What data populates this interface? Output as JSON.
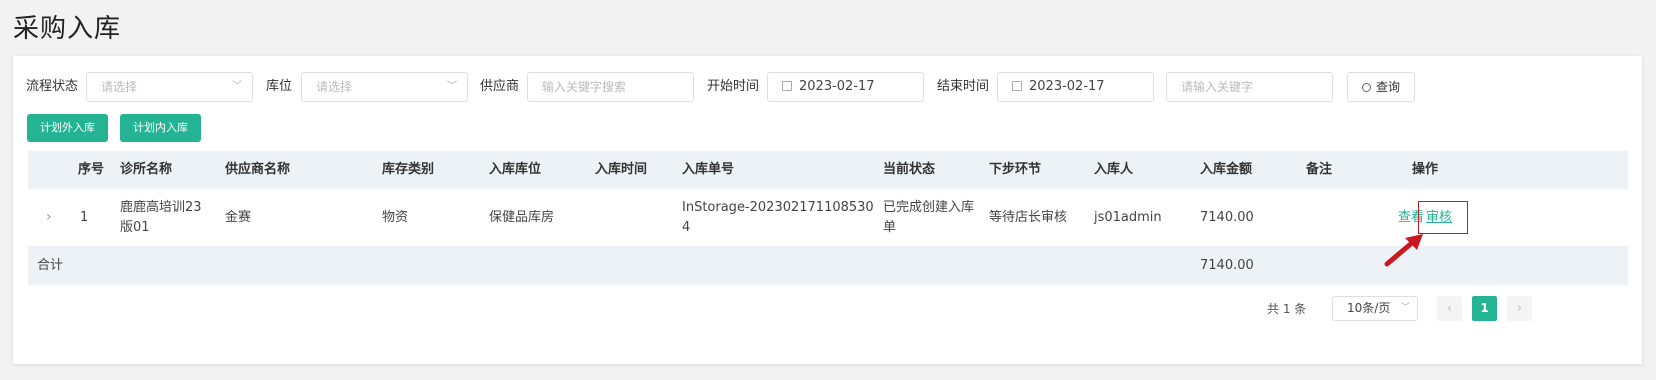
{
  "page": {
    "title": "采购入库"
  },
  "filters": {
    "status": {
      "label": "流程状态",
      "placeholder": "请选择"
    },
    "location": {
      "label": "库位",
      "placeholder": "请选择"
    },
    "supplier": {
      "label": "供应商",
      "placeholder": "输入关键字搜索"
    },
    "start": {
      "label": "开始时间",
      "value": "2023-02-17"
    },
    "end": {
      "label": "结束时间",
      "value": "2023-02-17"
    },
    "keyword": {
      "placeholder": "请输入关键字"
    },
    "query_label": "查询"
  },
  "actions": {
    "unplanned": "计划外入库",
    "planned": "计划内入库"
  },
  "table": {
    "headers": [
      "序号",
      "诊所名称",
      "供应商名称",
      "库存类别",
      "入库库位",
      "入库时间",
      "入库单号",
      "当前状态",
      "下步环节",
      "入库人",
      "入库金额",
      "备注",
      "操作"
    ],
    "rows": [
      {
        "index": "1",
        "clinic_line1": "鹿鹿高培训23",
        "clinic_line2": "版01",
        "supplier": "金赛",
        "category": "物资",
        "location": "保健品库房",
        "time": "",
        "order_line1": "InStorage-202302171108530",
        "order_line2": "4",
        "status_line1": "已完成创建入库",
        "status_line2": "单",
        "next_step": "等待店长审核",
        "operator": "js01admin",
        "amount": "7140.00",
        "remark": "",
        "op_view": "查看",
        "op_audit": "审核"
      }
    ],
    "summary": {
      "label": "合计",
      "amount": "7140.00"
    }
  },
  "pagination": {
    "total": "共 1 条",
    "page_size": "10条/页",
    "current": "1",
    "prev": "‹",
    "next": "›"
  },
  "colors": {
    "accent": "#24b494",
    "highlight": "#c9181f"
  }
}
